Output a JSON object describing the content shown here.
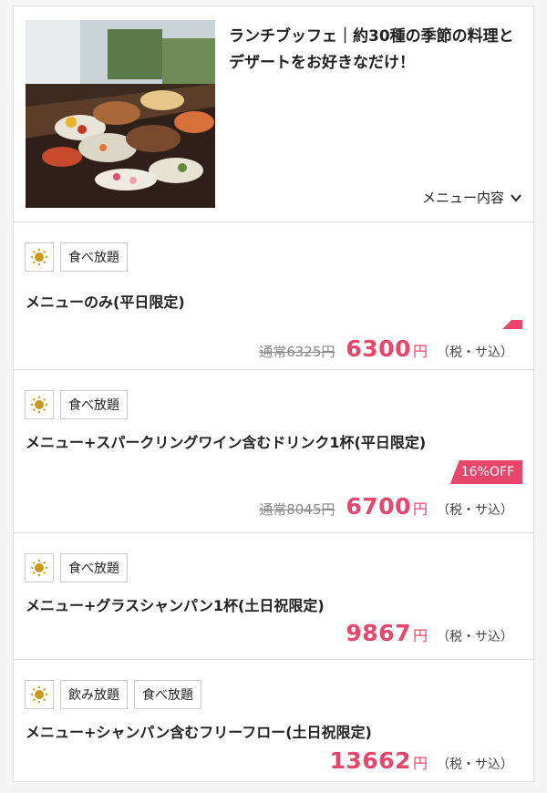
{
  "header": {
    "title": "ランチブッフェ｜約30種の季節の料理とデザートをお好きなだけ！",
    "menu_toggle_label": "メニュー内容"
  },
  "plans": [
    {
      "tags": [
        "食べ放題"
      ],
      "name": "メニューのみ(平日限定)",
      "discount": "",
      "regular_price": "通常6325円",
      "price": "6300",
      "yen": "円",
      "tax": "（税・サ込）"
    },
    {
      "tags": [
        "食べ放題"
      ],
      "name": "メニュー+スパークリングワイン含むドリンク1杯(平日限定)",
      "discount": "16%OFF",
      "regular_price": "通常8045円",
      "price": "6700",
      "yen": "円",
      "tax": "（税・サ込）"
    },
    {
      "tags": [
        "食べ放題"
      ],
      "name": "メニュー+グラスシャンパン1杯(土日祝限定)",
      "discount": "",
      "regular_price": "",
      "price": "9867",
      "yen": "円",
      "tax": "（税・サ込）"
    },
    {
      "tags": [
        "飲み放題",
        "食べ放題"
      ],
      "name": "メニュー+シャンパン含むフリーフロー(土日祝限定)",
      "discount": "",
      "regular_price": "",
      "price": "13662",
      "yen": "円",
      "tax": "（税・サ込）"
    }
  ],
  "colors": {
    "accent": "#e8466a",
    "sun": "#c99a1c",
    "border": "#dddddd"
  },
  "icons": {
    "lunch": "sun-icon",
    "toggle": "chevron-down-icon"
  }
}
